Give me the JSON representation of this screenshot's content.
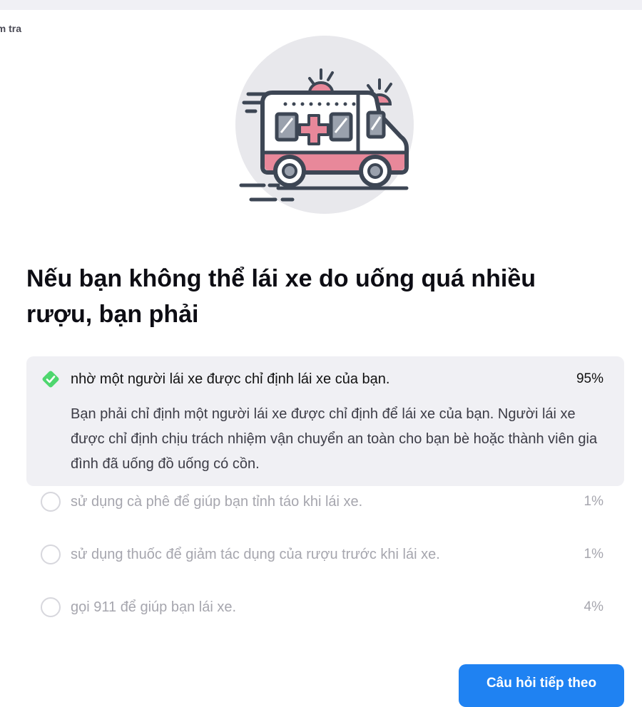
{
  "breadcrumb": "Kiểm tra",
  "question": "Nếu bạn không thể lái xe do uống quá nhiều rượu, bạn phải",
  "answers": [
    {
      "text": "nhờ một người lái xe được chỉ định lái xe của bạn.",
      "percent": "95%",
      "correct": true,
      "explanation": "Bạn phải chỉ định một người lái xe được chỉ định để lái xe của bạn. Người lái xe được chỉ định chịu trách nhiệm vận chuyển an toàn cho bạn bè hoặc thành viên gia đình đã uống đồ uống có cồn."
    },
    {
      "text": "sử dụng cà phê để giúp bạn tỉnh táo khi lái xe.",
      "percent": "1%",
      "correct": false
    },
    {
      "text": "sử dụng thuốc để giảm tác dụng của rượu trước khi lái xe.",
      "percent": "1%",
      "correct": false
    },
    {
      "text": "gọi 911 để giúp bạn lái xe.",
      "percent": "4%",
      "correct": false
    }
  ],
  "next_button": "Câu hỏi tiếp theo",
  "icons": {
    "illustration": "ambulance-icon",
    "correct_mark": "check-diamond-icon",
    "option_mark": "radio-circle-icon"
  },
  "colors": {
    "accent_blue": "#1f82f2",
    "correct_green": "#4ed66e",
    "ambulance_pink": "#e8889a",
    "outline_dark": "#3d4654",
    "muted_text": "#a6a6ae"
  }
}
